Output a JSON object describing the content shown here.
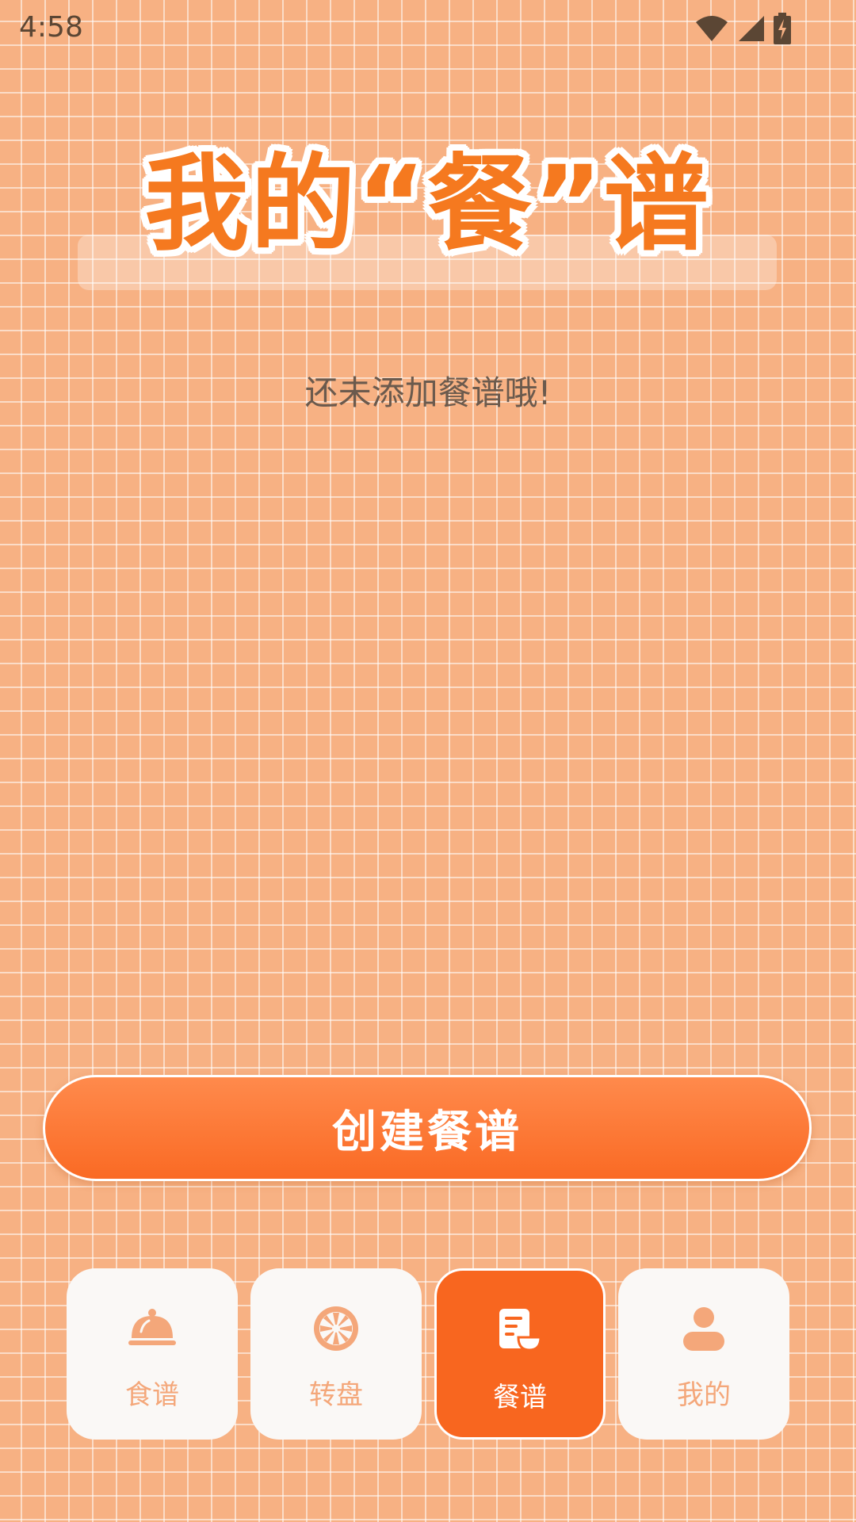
{
  "status_bar": {
    "time": "4:58"
  },
  "header": {
    "title": "我的“餐”谱"
  },
  "main": {
    "empty_message": "还未添加餐谱哦!"
  },
  "actions": {
    "create_label": "创建餐谱"
  },
  "bottom_nav": {
    "items": [
      {
        "label": "食谱",
        "icon": "cloche-icon",
        "active": false
      },
      {
        "label": "转盘",
        "icon": "wheel-icon",
        "active": false
      },
      {
        "label": "餐谱",
        "icon": "menu-card-icon",
        "active": true
      },
      {
        "label": "我的",
        "icon": "person-icon",
        "active": false
      }
    ]
  },
  "colors": {
    "background": "#f7b183",
    "accent": "#f8661f",
    "title": "#f5791f",
    "nav_inactive_text": "#f4a77a"
  }
}
